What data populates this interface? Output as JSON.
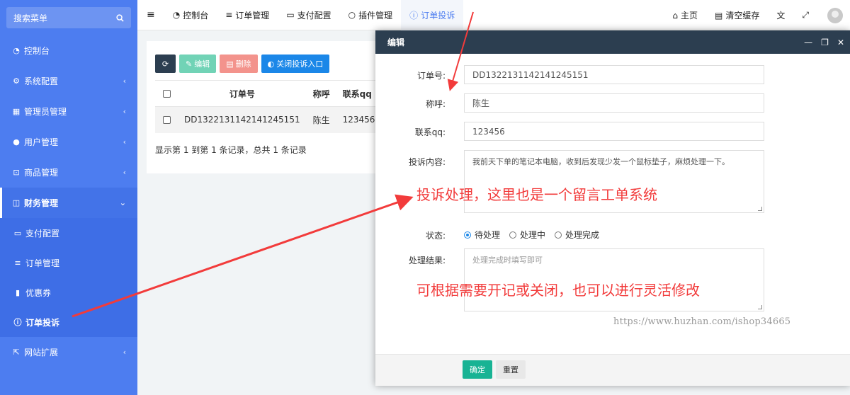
{
  "sidebar": {
    "search_placeholder": "搜索菜单",
    "items": [
      {
        "label": "控制台",
        "icon": "dashboard-icon"
      },
      {
        "label": "系统配置",
        "icon": "gears-icon"
      },
      {
        "label": "管理员管理",
        "icon": "windows-icon"
      },
      {
        "label": "用户管理",
        "icon": "user-icon"
      },
      {
        "label": "商品管理",
        "icon": "cart-icon"
      },
      {
        "label": "财务管理",
        "icon": "columns-icon"
      }
    ],
    "finance_sub": [
      {
        "label": "支付配置",
        "icon": "credit-card-icon"
      },
      {
        "label": "订单管理",
        "icon": "list-icon"
      },
      {
        "label": "优惠券",
        "icon": "bookmark-icon"
      },
      {
        "label": "订单投诉",
        "icon": "info-circle-icon"
      }
    ],
    "extend": {
      "label": "网站扩展",
      "icon": "external-link-icon"
    }
  },
  "topbar": {
    "tabs": [
      {
        "label": "控制台",
        "icon": "dashboard-icon"
      },
      {
        "label": "订单管理",
        "icon": "list-icon"
      },
      {
        "label": "支付配置",
        "icon": "credit-card-icon"
      },
      {
        "label": "插件管理",
        "icon": "circle-icon"
      },
      {
        "label": "订单投诉",
        "icon": "info-circle-icon"
      }
    ],
    "home": "主页",
    "clear_cache": "清空缓存"
  },
  "toolbar": {
    "edit": "编辑",
    "delete": "删除",
    "toggle_entry": "关闭投诉入口"
  },
  "table": {
    "headers": [
      "订单号",
      "称呼",
      "联系qq"
    ],
    "rows": [
      {
        "order_no": "DD1322131142141245151",
        "name": "陈生",
        "qq": "123456"
      }
    ],
    "pagination_info": "显示第 1 到第 1 条记录，总共 1 条记录"
  },
  "modal": {
    "title": "编辑",
    "fields": {
      "order_no": {
        "label": "订单号:",
        "value": "DD1322131142141245151"
      },
      "name": {
        "label": "称呼:",
        "value": "陈生"
      },
      "qq": {
        "label": "联系qq:",
        "value": "123456"
      },
      "content": {
        "label": "投诉内容:",
        "value": "我前天下单的笔记本电脑，收到后发现少发一个鼠标垫子，麻烦处理一下。"
      },
      "status": {
        "label": "状态:",
        "options": [
          "待处理",
          "处理中",
          "处理完成"
        ],
        "selected": "待处理"
      },
      "result": {
        "label": "处理结果:",
        "placeholder": "处理完成时填写即可"
      }
    },
    "confirm": "确定",
    "reset": "重置"
  },
  "annotations": {
    "note1": "投诉处理，这里也是一个留言工单系统",
    "note2": "可根据需要开记或关闭，也可以进行灵活修改",
    "watermark": "https://www.huzhan.com/ishop34665"
  },
  "colors": {
    "sidebar": "#4d7df0",
    "modal_header": "#2c3e50",
    "primary": "#1b87e8",
    "success": "#18b394",
    "annotation": "#f23b3b"
  }
}
